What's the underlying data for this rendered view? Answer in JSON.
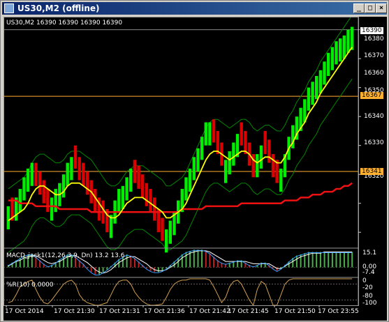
{
  "window": {
    "title": "US30,M2 (offline)",
    "buttons": {
      "minimize": "_",
      "maximize": "□",
      "close": "×"
    }
  },
  "main_chart": {
    "header": "US30,M2  16390 16390 16390 16390",
    "price_labels": [
      "16390",
      "16380",
      "16370",
      "16360",
      "16350",
      "16340",
      "16330",
      "16320"
    ],
    "current_price": "16390",
    "hline_labels": [
      "16367",
      "16341"
    ]
  },
  "macd": {
    "header": "MACD_jack1(12,26,3,9, Dn) 13.2 13.6",
    "labels": [
      "15.1",
      "0.00",
      "-7.4"
    ]
  },
  "wpr": {
    "header": "%R(10) 0.0000",
    "labels": [
      "0",
      "-20",
      "-80",
      "-100"
    ]
  },
  "time_axis": {
    "labels": [
      "17 Oct 2014",
      "17 Oct 21:30",
      "17 Oct 21:31",
      "17 Oct 21:36",
      "17 Oct 21:42",
      "17 Oct 21:45",
      "17 Oct 21:50",
      "17 Oct 23:55"
    ]
  },
  "colors": {
    "up_bar": "#00ee00",
    "down_bar": "#dd0000",
    "ma_fast": "#ffff00",
    "ma_slow": "#ee1111",
    "envelope": "#008800",
    "hline": "#ffb030",
    "macd_bar_up": "#4cae4c",
    "macd_bar_dn": "#c02020",
    "wpr_line": "#d2a050",
    "grid": "#666666"
  },
  "chart_data": {
    "type": "bar",
    "price_range": [
      16315,
      16394
    ],
    "close": [
      16328,
      16325,
      16331,
      16334,
      16338,
      16341,
      16343,
      16337,
      16334,
      16331,
      16328,
      16331,
      16334,
      16336,
      16339,
      16343,
      16345,
      16343,
      16339,
      16337,
      16334,
      16331,
      16328,
      16325,
      16324,
      16321,
      16325,
      16330,
      16334,
      16335,
      16338,
      16341,
      16338,
      16336,
      16333,
      16330,
      16328,
      16325,
      16321,
      16318,
      16320,
      16323,
      16326,
      16330,
      16334,
      16338,
      16341,
      16345,
      16348,
      16352,
      16357,
      16357,
      16352,
      16348,
      16344,
      16344,
      16347,
      16350,
      16353,
      16351,
      16348,
      16344,
      16340,
      16346,
      16349,
      16348,
      16345,
      16340,
      16338,
      16341,
      16346,
      16352,
      16356,
      16359,
      16362,
      16365,
      16369,
      16371,
      16373,
      16375,
      16378,
      16381,
      16383,
      16385,
      16386,
      16387,
      16389,
      16390
    ],
    "ma_fast": [
      16324,
      16325,
      16326,
      16327,
      16328,
      16330,
      16333,
      16335,
      16336,
      16336,
      16335,
      16334,
      16333,
      16333,
      16334,
      16336,
      16337,
      16337,
      16337,
      16336,
      16335,
      16334,
      16332,
      16330,
      16328,
      16326,
      16325,
      16325,
      16326,
      16328,
      16330,
      16331,
      16332,
      16332,
      16332,
      16331,
      16330,
      16329,
      16328,
      16327,
      16325,
      16325,
      16326,
      16327,
      16328,
      16330,
      16333,
      16336,
      16339,
      16342,
      16345,
      16347,
      16348,
      16348,
      16347,
      16346,
      16345,
      16346,
      16347,
      16348,
      16348,
      16347,
      16345,
      16344,
      16345,
      16346,
      16346,
      16345,
      16344,
      16344,
      16346,
      16349,
      16351,
      16354,
      16356,
      16358,
      16361,
      16363,
      16365,
      16368,
      16370,
      16372,
      16374,
      16376,
      16378,
      16380,
      16382,
      16384
    ],
    "ma_slow": [
      16331,
      16331,
      16331,
      16330,
      16330,
      16330,
      16330,
      16329,
      16329,
      16329,
      16329,
      16329,
      16329,
      16328,
      16328,
      16328,
      16328,
      16328,
      16328,
      16328,
      16328,
      16327,
      16327,
      16327,
      16327,
      16327,
      16327,
      16327,
      16327,
      16327,
      16327,
      16327,
      16327,
      16327,
      16327,
      16327,
      16327,
      16327,
      16327,
      16327,
      16327,
      16327,
      16327,
      16327,
      16328,
      16328,
      16328,
      16328,
      16328,
      16328,
      16329,
      16329,
      16329,
      16329,
      16329,
      16329,
      16329,
      16329,
      16329,
      16330,
      16330,
      16330,
      16330,
      16330,
      16330,
      16330,
      16330,
      16330,
      16330,
      16330,
      16331,
      16331,
      16331,
      16331,
      16332,
      16332,
      16332,
      16333,
      16333,
      16333,
      16334,
      16334,
      16334,
      16335,
      16335,
      16336,
      16336,
      16337
    ],
    "macd_histogram": [
      2,
      4,
      6,
      8,
      10,
      11,
      11,
      9,
      6,
      3,
      1,
      2,
      4,
      7,
      9,
      11,
      11,
      9,
      6,
      3,
      -1,
      -4,
      -6,
      -6,
      -4,
      -2,
      1,
      4,
      7,
      9,
      11,
      10,
      8,
      5,
      2,
      -1,
      -3,
      -4,
      -4,
      -3,
      -1,
      2,
      5,
      8,
      11,
      13,
      14,
      15,
      15,
      15,
      14,
      12,
      9,
      6,
      4,
      3,
      4,
      5,
      6,
      6,
      4,
      2,
      1,
      2,
      4,
      4,
      2,
      -1,
      -3,
      -1,
      2,
      5,
      8,
      10,
      11,
      12,
      13,
      13,
      13,
      13,
      13,
      13,
      13,
      13,
      13,
      13,
      13,
      13
    ],
    "macd_signal": [
      1,
      3,
      5,
      6,
      8,
      9,
      10,
      10,
      8,
      6,
      4,
      3,
      4,
      5,
      7,
      9,
      10,
      10,
      8,
      6,
      4,
      1,
      -2,
      -4,
      -5,
      -4,
      -2,
      1,
      4,
      6,
      8,
      9,
      9,
      7,
      5,
      3,
      0,
      -2,
      -3,
      -3,
      -2,
      0,
      2,
      5,
      8,
      10,
      12,
      13,
      14,
      14,
      14,
      13,
      11,
      9,
      7,
      5,
      5,
      5,
      5,
      5,
      5,
      4,
      3,
      3,
      3,
      3,
      3,
      1,
      -1,
      -1,
      1,
      3,
      5,
      7,
      9,
      10,
      11,
      12,
      12,
      12,
      13,
      13,
      13,
      13,
      13,
      13,
      13,
      13
    ],
    "wpr": [
      -90,
      -85,
      -60,
      -30,
      -20,
      -10,
      -5,
      -40,
      -70,
      -90,
      -95,
      -80,
      -60,
      -40,
      -20,
      -10,
      -5,
      -20,
      -60,
      -80,
      -90,
      -95,
      -100,
      -100,
      -95,
      -90,
      -60,
      -30,
      -10,
      -5,
      -5,
      -20,
      -50,
      -70,
      -85,
      -95,
      -100,
      -100,
      -98,
      -95,
      -70,
      -40,
      -20,
      -10,
      -5,
      -5,
      0,
      0,
      0,
      0,
      0,
      -5,
      -30,
      -60,
      -90,
      -70,
      -30,
      -10,
      -5,
      -20,
      -50,
      -80,
      -100,
      -40,
      -10,
      -20,
      -60,
      -100,
      -100,
      -60,
      -20,
      -5,
      0,
      0,
      0,
      0,
      0,
      0,
      0,
      0,
      0,
      0,
      0,
      0,
      0,
      0,
      0,
      0
    ],
    "price_ylim": [
      16315,
      16394
    ],
    "macd_ylim": [
      -7.4,
      15.1
    ],
    "wpr_ylim": [
      -100,
      0
    ]
  }
}
